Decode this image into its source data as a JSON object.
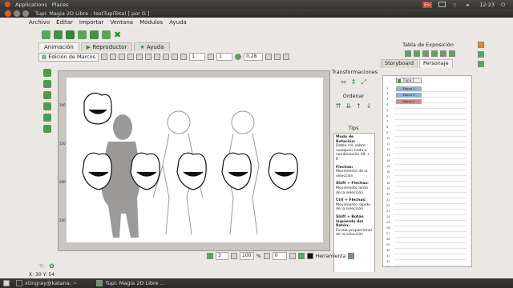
{
  "system_panel": {
    "menu": [
      "Applications",
      "Places"
    ],
    "keyboard": "En",
    "time": "12:23"
  },
  "window": {
    "title": "Tupi: Magia 2D Libre - testTupiTotal [ por G ]"
  },
  "menubar": [
    "Archivo",
    "Editar",
    "Importar",
    "Ventana",
    "Módulos",
    "Ayuda"
  ],
  "tabs": [
    {
      "label": "Animación",
      "active": true
    },
    {
      "label": "Reproductor",
      "active": false
    },
    {
      "label": "Ayuda",
      "active": false
    }
  ],
  "anim_toolbar": {
    "frames_button": "Edición de Marcos",
    "spin1": "1",
    "spin2": "1",
    "opacity": "0,28"
  },
  "transform_panel": {
    "title": "Transformaciones",
    "order_title": "Ordenar",
    "tips_title": "Tips",
    "tips": [
      {
        "head": "Modo de Rotación:",
        "body": "Doble clic sobre cualquier nodo o combinación Alt + R"
      },
      {
        "head": "Flechas:",
        "body": "Movimiento de la selección"
      },
      {
        "head": "Shift + Flechas:",
        "body": "Movimiento lento de la selección"
      },
      {
        "head": "Ctrl + Flechas:",
        "body": "Movimiento rápido de la selección"
      },
      {
        "head": "Shift + Botón Izquierdo del Ratón:",
        "body": "Escala proporcional de la selección"
      }
    ]
  },
  "canvas_status": {
    "frame": "3",
    "zoom": "100",
    "percent": "%",
    "rotation": "0",
    "tool_label": "Herramienta"
  },
  "exposure": {
    "title": "Tabla de Exposición",
    "tabs": [
      "Storyboard",
      "Personaje"
    ],
    "layer": "Capa 1",
    "frames": [
      "Marco 1",
      "Marco 2",
      "Marco 3"
    ],
    "row_numbers": [
      "1",
      "2",
      "3",
      "4",
      "5",
      "6",
      "7",
      "8",
      "9",
      "10",
      "11",
      "12",
      "13",
      "14",
      "15",
      "16",
      "17",
      "18",
      "19",
      "20",
      "21",
      "22",
      "23",
      "24",
      "25",
      "26",
      "27",
      "28",
      "29",
      "30",
      "31",
      "32",
      "33"
    ]
  },
  "statusbar": {
    "coords": "X: 30 Y: 54"
  },
  "taskbar": {
    "items": [
      "xtingray@katana: ~",
      "Tupi: Magia 2D Libre ..."
    ]
  },
  "ruler_labels": [
    "100",
    "150",
    "200",
    "250"
  ],
  "colors": {
    "accent_green": "#2e8b2e",
    "selected_frame": "#8ab4e8",
    "selected_frame_last": "#d08a8a",
    "layer_green": "#3a9a3a"
  }
}
